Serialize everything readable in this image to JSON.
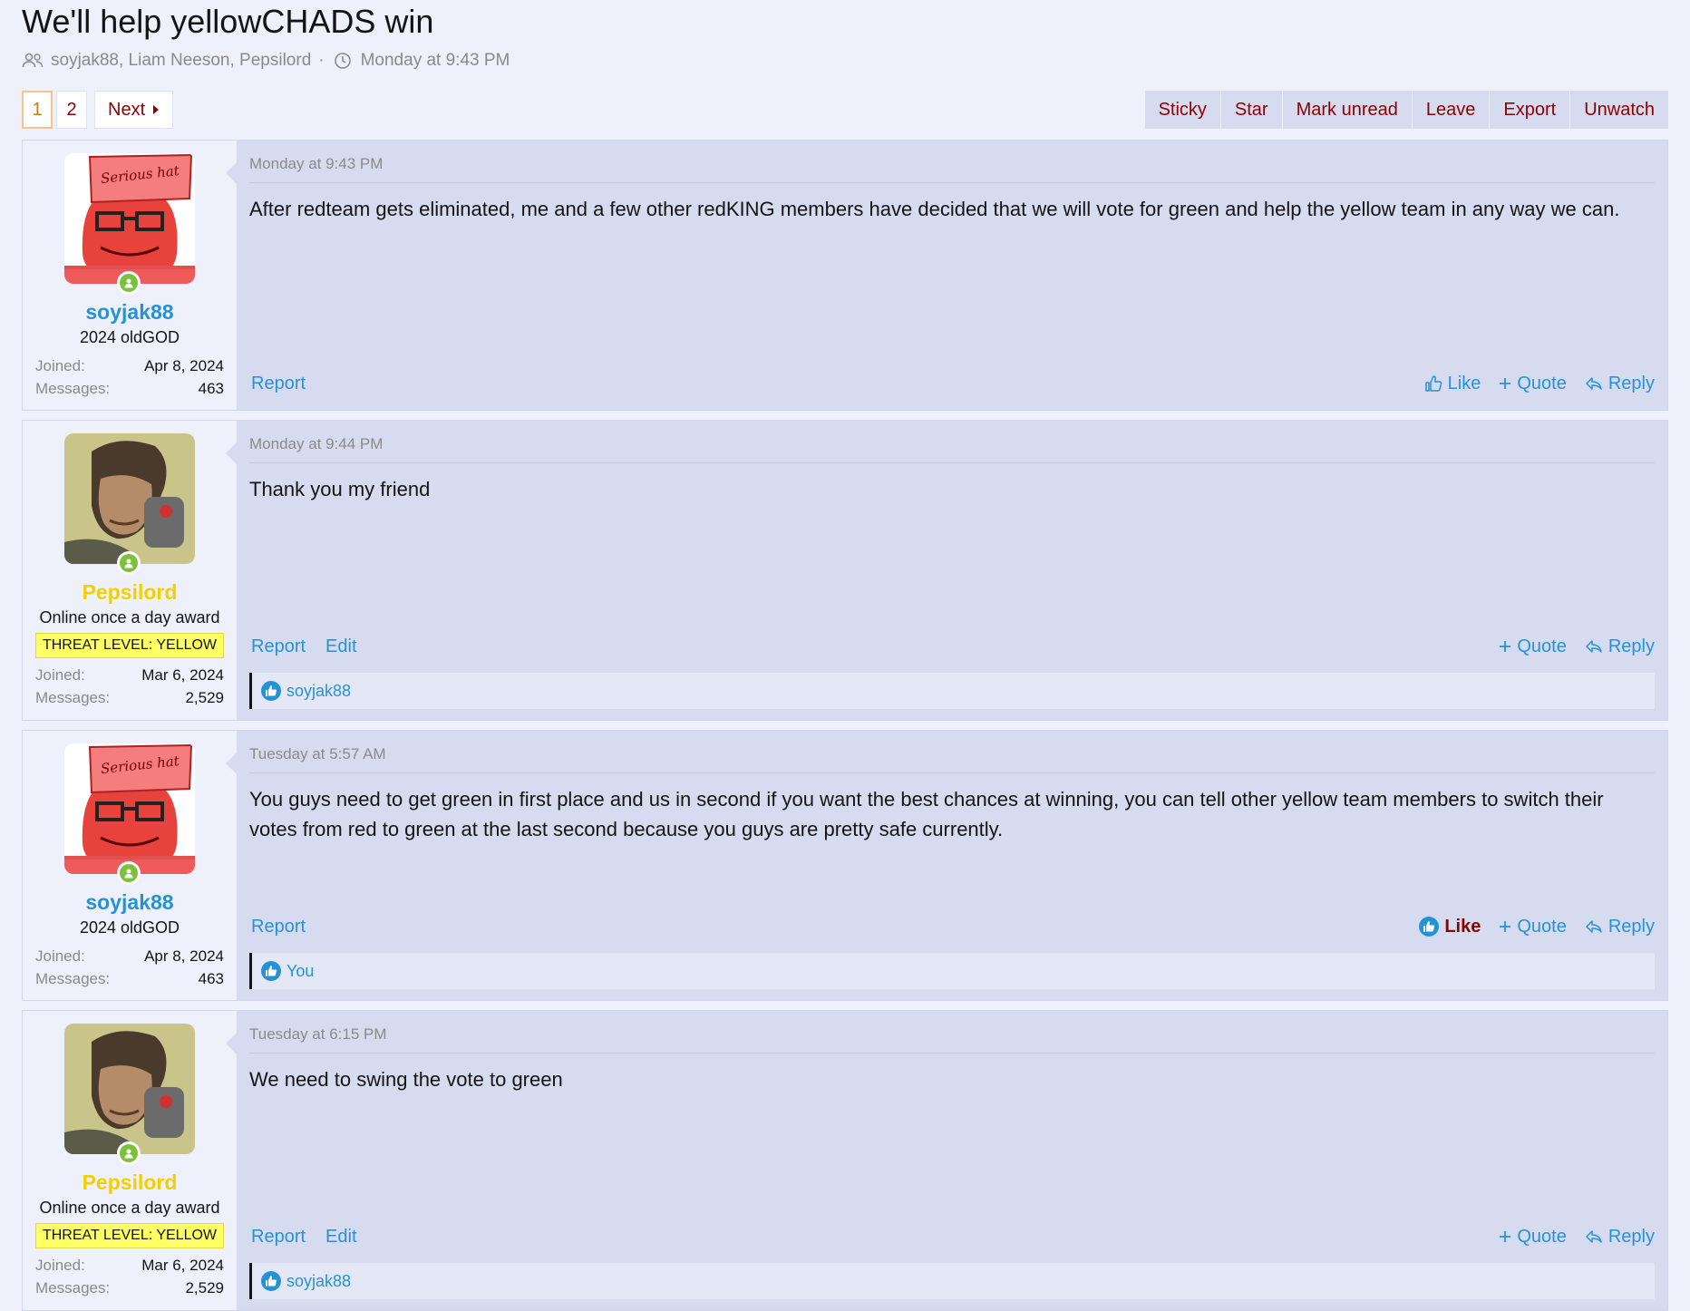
{
  "thread": {
    "title": "We'll help yellowCHADS win",
    "participants": "soyjak88, Liam Neeson, Pepsilord",
    "separator": "·",
    "started": "Monday at 9:43 PM"
  },
  "pagination": {
    "pages": [
      "1",
      "2"
    ],
    "current": "1",
    "next_label": "Next"
  },
  "thread_actions": [
    "Sticky",
    "Star",
    "Mark unread",
    "Leave",
    "Export",
    "Unwatch"
  ],
  "labels": {
    "joined": "Joined:",
    "messages": "Messages:",
    "report": "Report",
    "edit": "Edit",
    "like": "Like",
    "quote": "Quote",
    "reply": "Reply"
  },
  "colors": {
    "accent_red": "#8b0000",
    "link_blue": "#2592d6",
    "username_yellow": "#f2d000",
    "online_green": "#7cc13c"
  },
  "posts": [
    {
      "user": {
        "name": "soyjak88",
        "title": "2024 oldGOD",
        "joined": "Apr 8, 2024",
        "messages": "463",
        "avatar_icon": "serious-hat-soyjak-avatar",
        "avatar_text": "Serious hat"
      },
      "date": "Monday at 9:43 PM",
      "body": "After redteam gets eliminated, me and a few other redKING members have decided that we will vote for green and help the yellow team in any way we can."
    },
    {
      "user": {
        "name": "Pepsilord",
        "title": "Online once a day award",
        "banner": "THREAT LEVEL: YELLOW",
        "joined": "Mar 6, 2024",
        "messages": "2,529",
        "avatar_icon": "soldier-portrait-avatar"
      },
      "date": "Monday at 9:44 PM",
      "body": "Thank you my friend",
      "reactions": "soyjak88"
    },
    {
      "user": {
        "name": "soyjak88",
        "title": "2024 oldGOD",
        "joined": "Apr 8, 2024",
        "messages": "463",
        "avatar_icon": "serious-hat-soyjak-avatar",
        "avatar_text": "Serious hat"
      },
      "date": "Tuesday at 5:57 AM",
      "body": "You guys need to get green in first place and us in second if you want the best chances at winning, you can tell other yellow team members to switch their votes from red to green at the last second because you guys are pretty safe currently.",
      "reactions": "You"
    },
    {
      "user": {
        "name": "Pepsilord",
        "title": "Online once a day award",
        "banner": "THREAT LEVEL: YELLOW",
        "joined": "Mar 6, 2024",
        "messages": "2,529",
        "avatar_icon": "soldier-portrait-avatar"
      },
      "date": "Tuesday at 6:15 PM",
      "body": "We need to swing the vote to green",
      "reactions": "soyjak88"
    }
  ]
}
